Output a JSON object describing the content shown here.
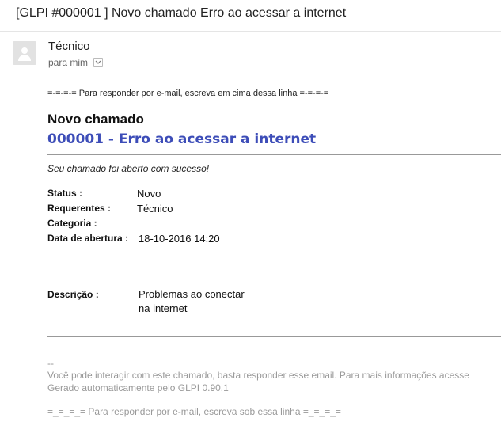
{
  "email": {
    "subject": "[GLPI #000001 ] Novo chamado Erro ao acessar a internet",
    "sender": "Técnico",
    "recipient_label": "para mim"
  },
  "body": {
    "reply_above": "=-=-=-= Para responder por e-mail, escreva em cima dessa linha =-=-=-=",
    "heading": "Novo chamado",
    "ticket_title": "000001 - Erro ao acessar a internet",
    "confirmation": "Seu chamado foi aberto com sucesso!",
    "fields": {
      "status_label": "Status :",
      "status_value": "Novo",
      "requerentes_label": "Requerentes :",
      "requerentes_value": "Técnico",
      "categoria_label": "Categoria :",
      "data_label": "Data de abertura :",
      "data_value": "18-10-2016 14:20",
      "descricao_label": "Descrição :",
      "descricao_line1": "Problemas ao conectar",
      "descricao_line2": "na internet"
    }
  },
  "footer": {
    "separator": "--",
    "info": "Você pode interagir com este chamado, basta responder esse email. Para mais informações acesse",
    "generated": "Gerado automaticamente pelo GLPI 0.90.1",
    "reply_below": "=_=_=_= Para responder por e-mail, escreva sob essa linha =_=_=_="
  }
}
